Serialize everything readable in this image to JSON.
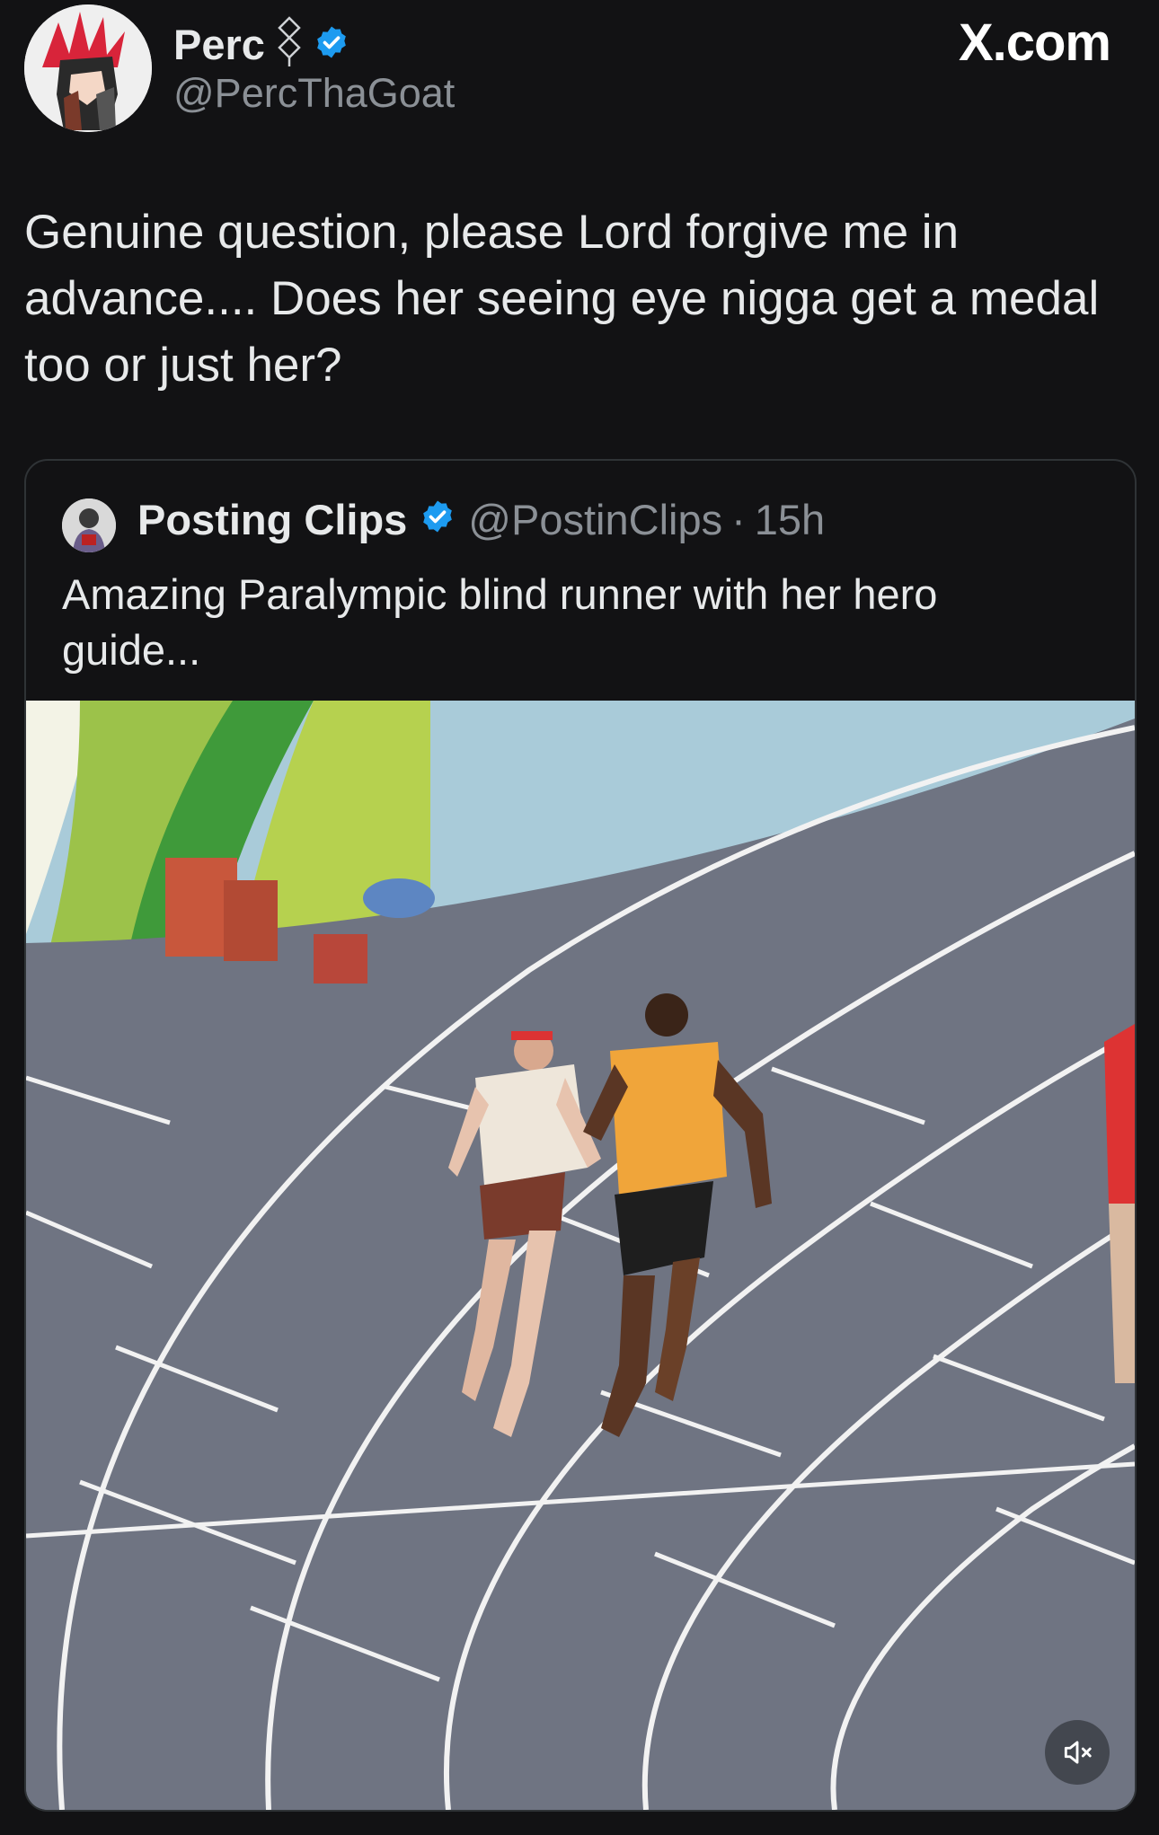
{
  "author": {
    "display_name": "Perc",
    "handle": "@PercThaGoat",
    "verified": true,
    "badge_icon": "plug-icon"
  },
  "brand": {
    "label": "X.com"
  },
  "tweet": {
    "text": "Genuine question, please Lord forgive me in advance.... Does her seeing eye nigga get a medal too or just her?"
  },
  "quoted_post": {
    "display_name": "Posting Clips",
    "handle": "@PostinClips",
    "separator": "·",
    "time": "15h",
    "verified": true,
    "text": "Amazing Paralympic blind runner with her hero guide...",
    "media": {
      "type": "video",
      "muted": true,
      "mute_icon": "volume-muted-icon"
    }
  },
  "colors": {
    "background": "#121214",
    "primary_text": "#e7e9ea",
    "secondary_text": "#8b9096",
    "verified_blue": "#1d9bf0",
    "card_border": "#2f3336"
  }
}
